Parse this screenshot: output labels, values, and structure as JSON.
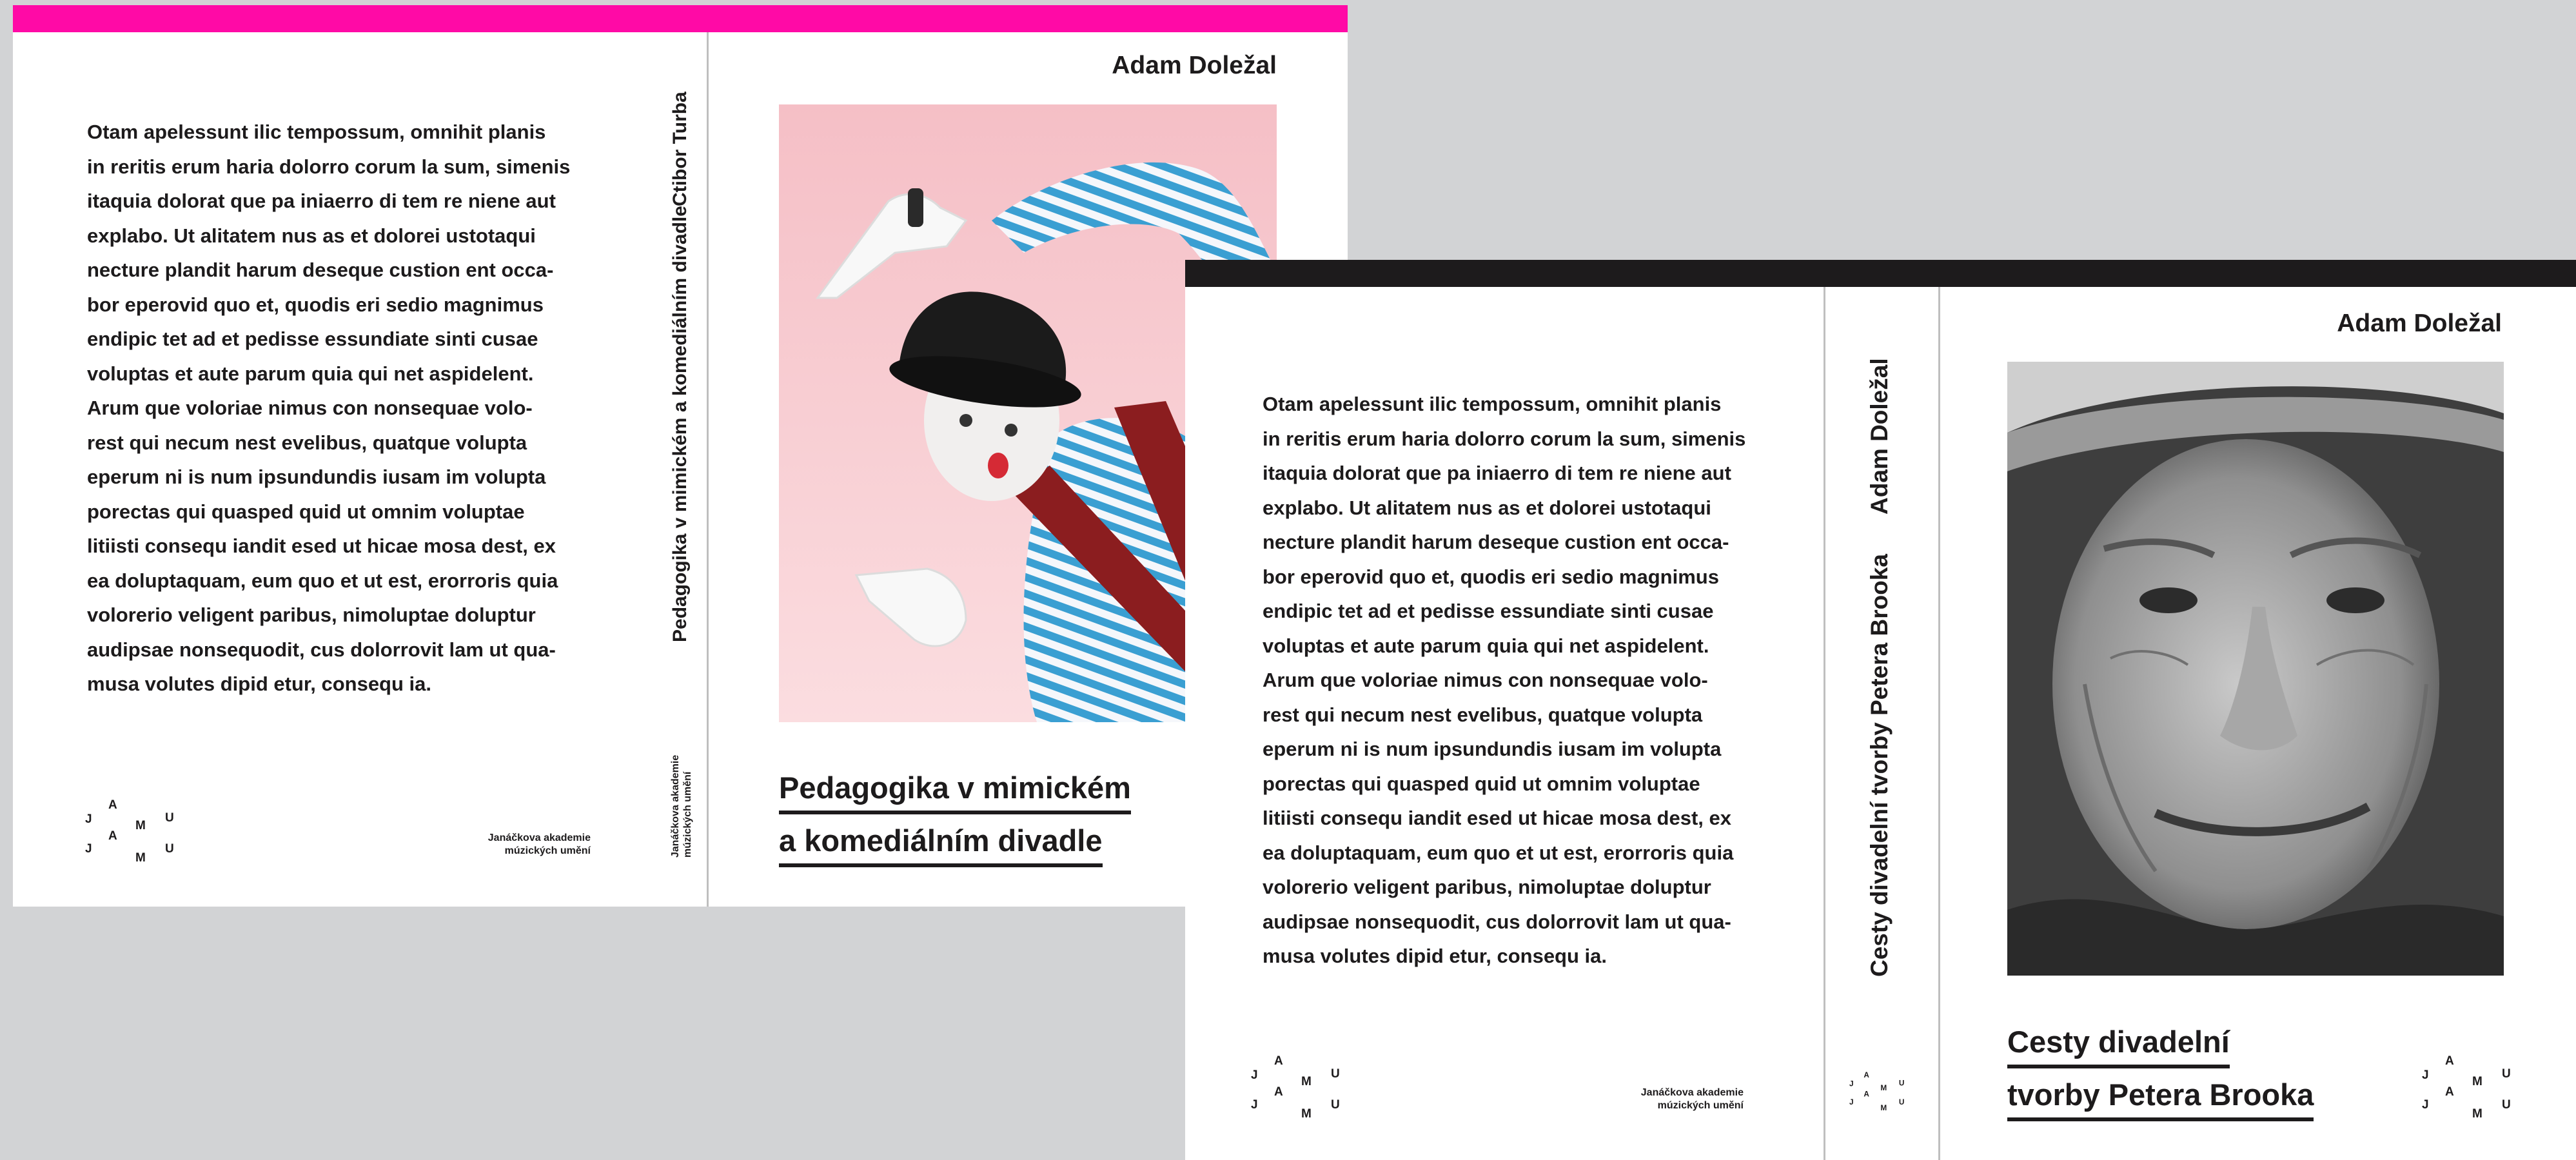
{
  "colors": {
    "background": "#d2d3d5",
    "cover_1_accent": "#ff0aa6",
    "cover_2_accent": "#1d1b1c"
  },
  "cover_1": {
    "author": "Adam Doležal",
    "spine_author": "Ctibor Turba",
    "spine_title": "Pedagogika v mimickém a komediálním divadle",
    "title_lines": [
      "Pedagogika v mimickém",
      "a komediálním divadle"
    ],
    "blurb": "Otam apelessunt ilic tempossum, omnihit planis\nin reritis erum haria dolorro corum la sum, simenis\nitaquia dolorat que pa iniaerro di tem re niene aut\nexplabo. Ut alitatem nus as et dolorei ustotaqui\nnecture plandit harum deseque custion ent occa-\nbor eperovid quo et, quodis eri sedio magnimus\nendipic tet ad et pedisse essundiate sinti cusae\nvoluptas et aute parum quia qui net aspidelent.\nArum que voloriae nimus con nonsequae volo-\nrest qui necum nest evelibus, quatque volupta\neperum ni is num ipsundundis iusam im volupta\nporectas qui quasped quid ut omnim voluptae\nlitiisti consequ iandit esed ut hicae mosa dest, ex\nea doluptaquam, eum quo et ut est, erorroris quia\nvolorerio veligent paribus, nimoluptae doluptur\naudipsae nonsequodit, cus dolorrovit lam ut qua-\nmusa volutes dipid etur, consequ ia.",
    "publisher": "Janáčkova akademie\nmúzických umění",
    "logo_letters": [
      "J",
      "A",
      "M",
      "U",
      "J",
      "A",
      "M",
      "U"
    ],
    "photo_icon": "mime-photo"
  },
  "cover_2": {
    "author": "Adam Doležal",
    "spine_author": "Adam Doležal",
    "spine_title": "Cesty divadelní tvorby Petera Brooka",
    "title_lines": [
      "Cesty divadelní",
      "tvorby Petera Brooka"
    ],
    "blurb": "Otam apelessunt ilic tempossum, omnihit planis\nin reritis erum haria dolorro corum la sum, simenis\nitaquia dolorat que pa iniaerro di tem re niene aut\nexplabo. Ut alitatem nus as et dolorei ustotaqui\nnecture plandit harum deseque custion ent occa-\nbor eperovid quo et, quodis eri sedio magnimus\nendipic tet ad et pedisse essundiate sinti cusae\nvoluptas et aute parum quia qui net aspidelent.\nArum que voloriae nimus con nonsequae volo-\nrest qui necum nest evelibus, quatque volupta\neperum ni is num ipsundundis iusam im volupta\nporectas qui quasped quid ut omnim voluptae\nlitiisti consequ iandit esed ut hicae mosa dest, ex\nea doluptaquam, eum quo et ut est, erorroris quia\nvolorerio veligent paribus, nimoluptae doluptur\naudipsae nonsequodit, cus dolorrovit lam ut qua-\nmusa volutes dipid etur, consequ ia.",
    "publisher": "Janáčkova akademie\nmúzických umění",
    "logo_letters": [
      "J",
      "A",
      "M",
      "U",
      "J",
      "A",
      "M",
      "U"
    ],
    "photo_icon": "portrait-photo"
  }
}
